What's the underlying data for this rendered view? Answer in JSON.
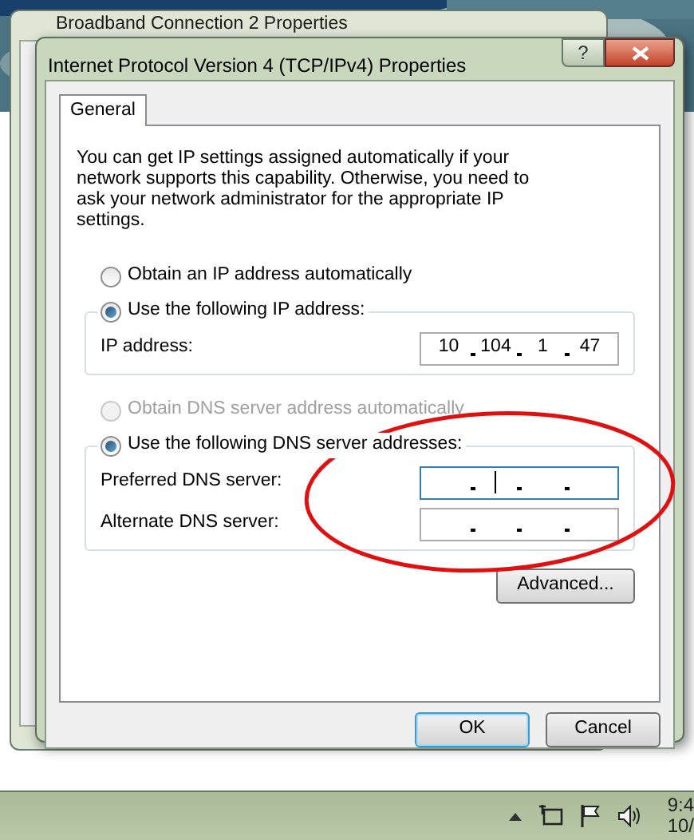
{
  "background_window": {
    "title": "Broadband Connection 2 Properties"
  },
  "dialog": {
    "title": "Internet Protocol Version 4 (TCP/IPv4) Properties",
    "help_label": "?",
    "tabs": [
      {
        "label": "General",
        "selected": true
      }
    ],
    "description": "You can get IP settings assigned automatically if your network supports this capability. Otherwise, you need to ask your network administrator for the appropriate IP settings.",
    "ip_section": {
      "radios": [
        {
          "label": "Obtain an IP address automatically",
          "selected": false,
          "disabled": false
        },
        {
          "label": "Use the following IP address:",
          "selected": true,
          "disabled": false
        }
      ],
      "fields": [
        {
          "label": "IP address:",
          "octets": [
            "10",
            "104",
            "1",
            "47"
          ],
          "focused": false
        }
      ]
    },
    "dns_section": {
      "radios": [
        {
          "label": "Obtain DNS server address automatically",
          "selected": false,
          "disabled": true
        },
        {
          "label": "Use the following DNS server addresses:",
          "selected": true,
          "disabled": false
        }
      ],
      "fields": [
        {
          "label": "Preferred DNS server:",
          "focused": true
        },
        {
          "label": "Alternate DNS server:",
          "focused": false
        }
      ]
    },
    "advanced_button": "Advanced...",
    "buttons": [
      {
        "label": "OK",
        "default": true
      },
      {
        "label": "Cancel",
        "default": false
      }
    ]
  },
  "taskbar": {
    "time": "9:4",
    "date": "10/"
  }
}
